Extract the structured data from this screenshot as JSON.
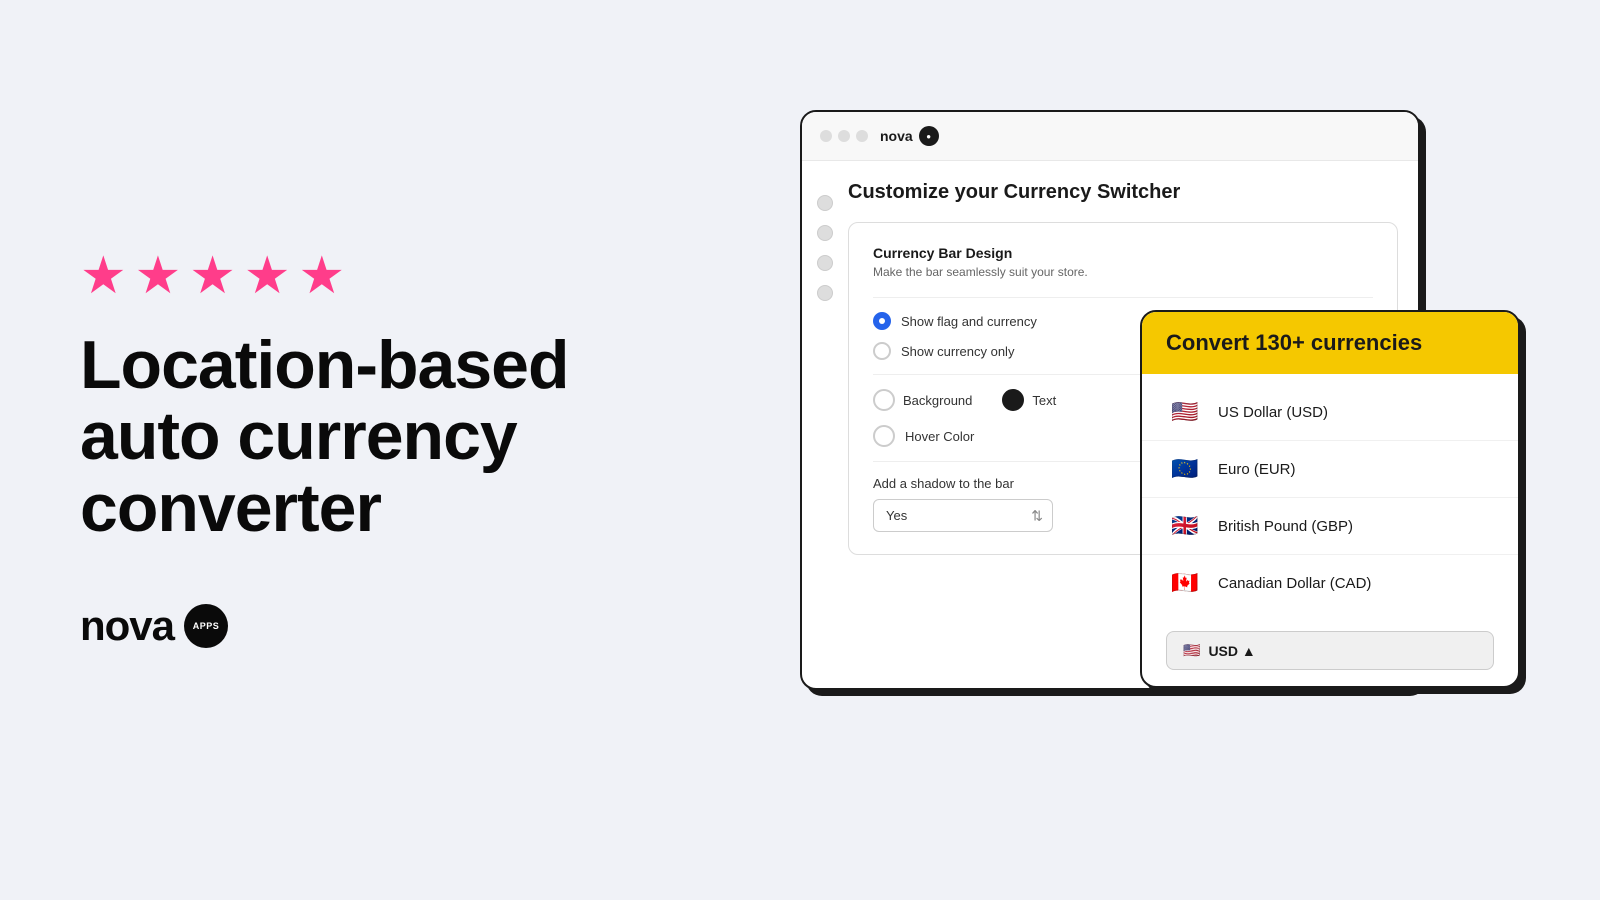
{
  "left": {
    "stars": [
      "★",
      "★",
      "★",
      "★",
      "★"
    ],
    "headline": "Location-based auto currency converter",
    "logo": {
      "wordmark": "nova",
      "badge": "apps"
    }
  },
  "browser": {
    "title_bar": {
      "url_text": "nova",
      "badge_text": "●"
    },
    "page": {
      "title": "Customize your Currency Switcher",
      "card": {
        "title": "Currency Bar Design",
        "subtitle": "Make the bar seamlessly suit your store.",
        "option1": "Show flag and currency",
        "option2": "Show currency only",
        "background_label": "Background",
        "text_label": "Text",
        "hover_label": "Hover Color",
        "shadow_label": "Add a shadow to the bar",
        "shadow_value": "Yes"
      }
    }
  },
  "currency_card": {
    "header": "Convert 130+ currencies",
    "currencies": [
      {
        "flag": "🇺🇸",
        "name": "US Dollar (USD)"
      },
      {
        "flag": "🇪🇺",
        "name": "Euro (EUR)"
      },
      {
        "flag": "🇬🇧",
        "name": "British Pound (GBP)"
      },
      {
        "flag": "🇨🇦",
        "name": "Canadian Dollar (CAD)"
      }
    ],
    "bar_text": "USD ▲"
  }
}
